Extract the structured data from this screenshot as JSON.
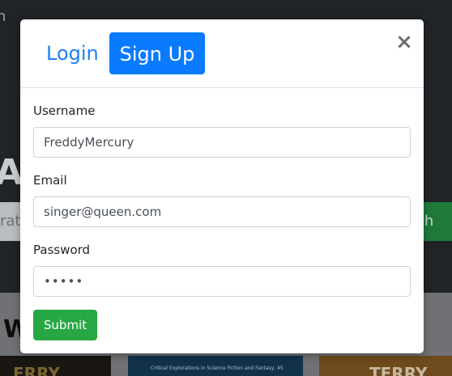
{
  "background": {
    "nav_fragment": "h",
    "hero_letter": "A",
    "search_placeholder_fragment": "rat",
    "search_button_fragment": "ch",
    "lower_heading_fragment": "W",
    "cards": [
      {
        "text": "ERRY"
      },
      {
        "text": "Critical Explorations in Science Fiction and Fantasy, 45"
      },
      {
        "text": "TERRY"
      }
    ]
  },
  "modal": {
    "tabs": {
      "login_label": "Login",
      "signup_label": "Sign Up",
      "active": "signup"
    },
    "close_label": "×",
    "form": {
      "username_label": "Username",
      "username_value": "FreddyMercury",
      "email_label": "Email",
      "email_value": "singer@queen.com",
      "password_label": "Password",
      "password_value": "•••••",
      "submit_label": "Submit"
    }
  },
  "colors": {
    "primary": "#0a7bff",
    "success": "#28a745",
    "link": "#1d7ef5"
  }
}
